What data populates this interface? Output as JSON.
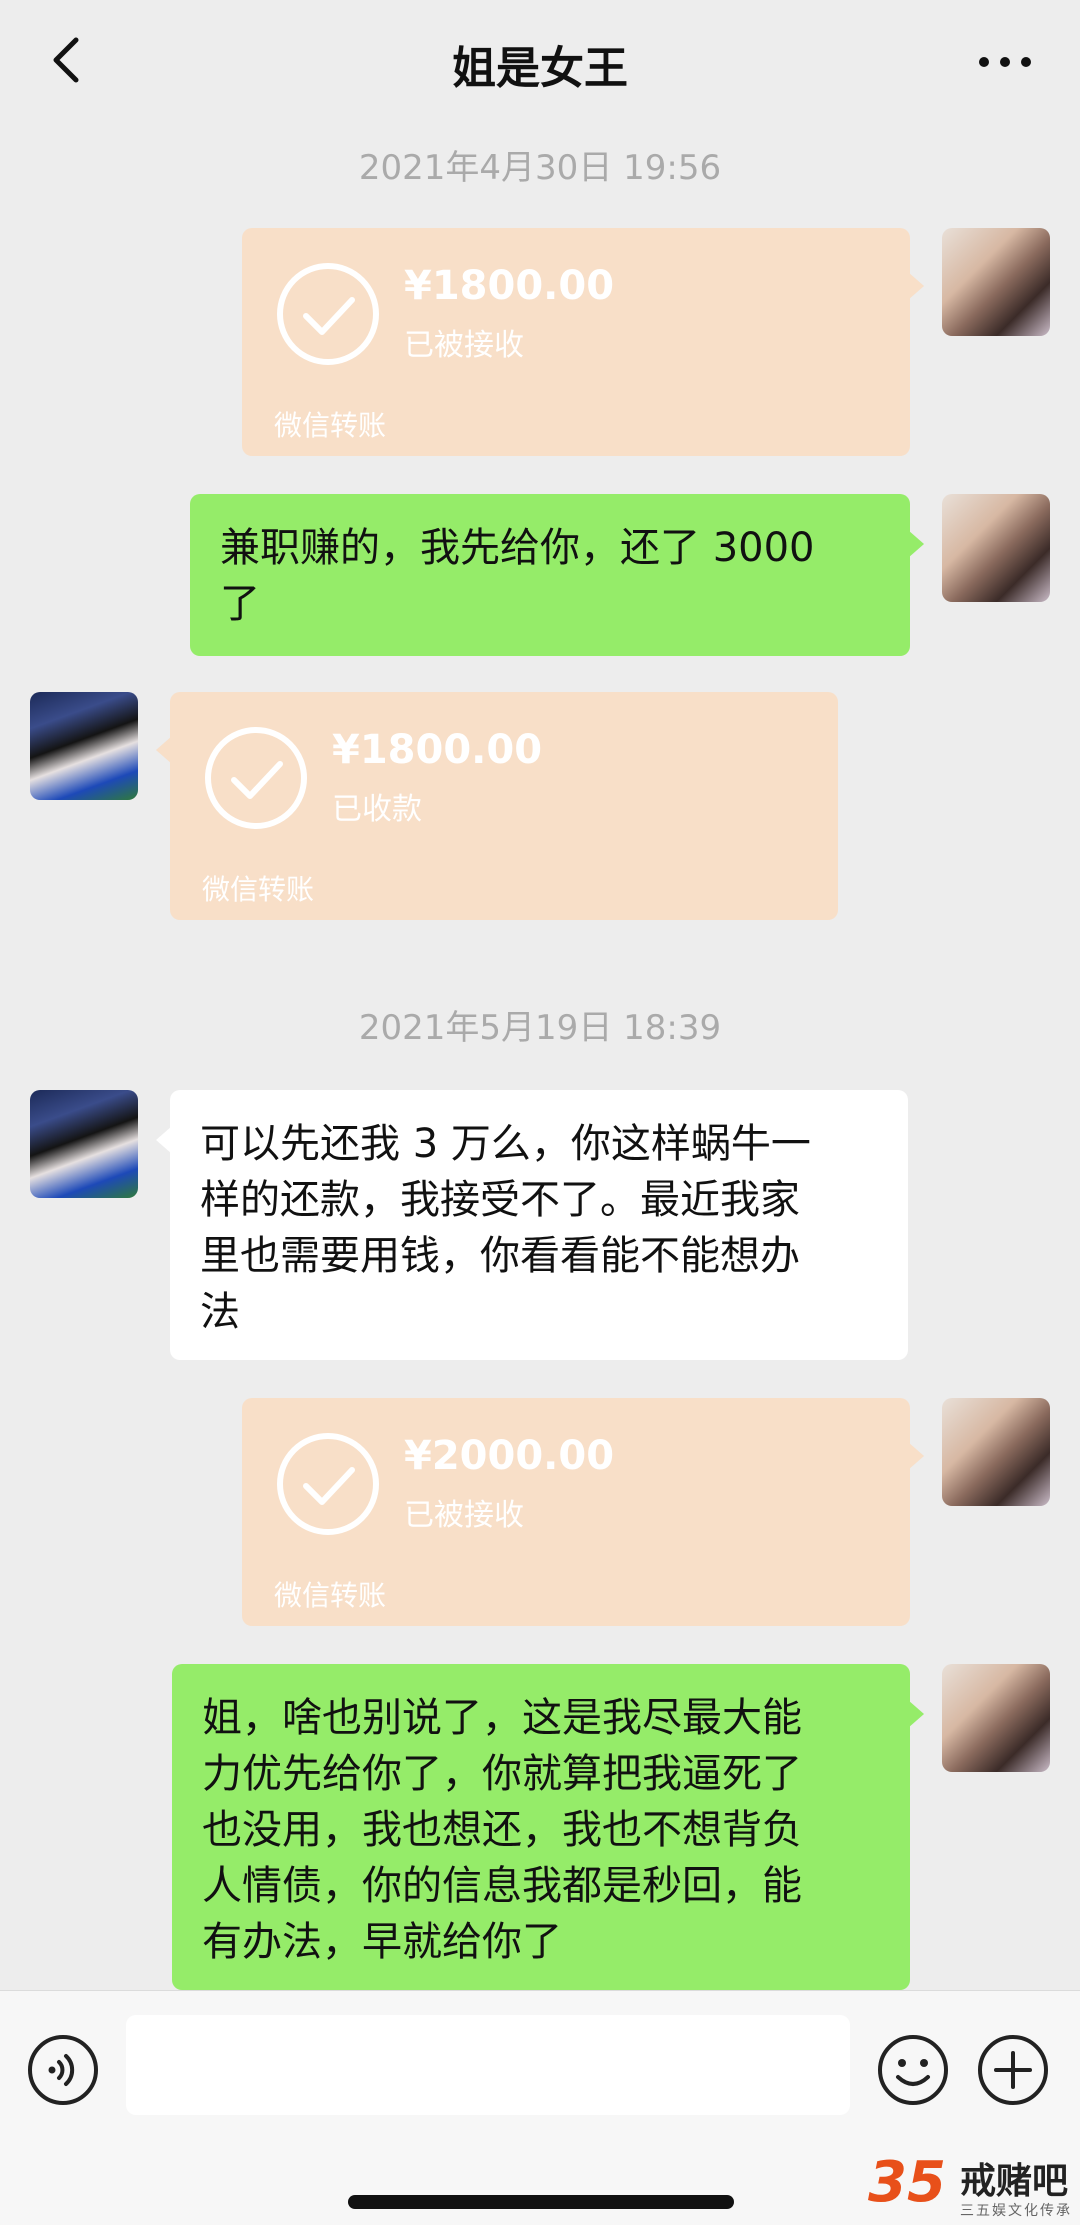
{
  "header": {
    "title": "姐是女王",
    "back_icon": "chevron-left-icon",
    "more_icon": "more-horizontal-icon"
  },
  "messages": {
    "ts1": "2021年4月30日 19:56",
    "m1": {
      "amount": "¥1800.00",
      "status": "已被接收",
      "label": "微信转账"
    },
    "m2": {
      "line1": "兼职赚的，我先给你，还了 3000",
      "line2": "了"
    },
    "m3": {
      "amount": "¥1800.00",
      "status": "已收款",
      "label": "微信转账"
    },
    "ts2": "2021年5月19日 18:39",
    "m4": {
      "line1": "可以先还我 3 万么，你这样蜗牛一",
      "line2": "样的还款，我接受不了。最近我家",
      "line3": "里也需要用钱，你看看能不能想办",
      "line4": "法"
    },
    "m5": {
      "amount": "¥2000.00",
      "status": "已被接收",
      "label": "微信转账"
    },
    "m6": {
      "line1": "姐，啥也别说了，这是我尽最大能",
      "line2": "力优先给你了，你就算把我逼死了",
      "line3": "也没用，我也想还，我也不想背负",
      "line4": "人情债，你的信息我都是秒回，能",
      "line5": "有办法，早就给你了"
    }
  },
  "input_bar": {
    "voice_icon": "voice-icon",
    "emoji_icon": "emoji-icon",
    "plus_icon": "plus-icon",
    "input_value": ""
  },
  "watermark": {
    "number": "35",
    "text": "戒赌吧",
    "sub": "三五娱文化传承"
  },
  "colors": {
    "background": "#ededed",
    "transfer_card": "#f8dfc8",
    "my_bubble": "#95ec69",
    "their_bubble": "#ffffff"
  }
}
